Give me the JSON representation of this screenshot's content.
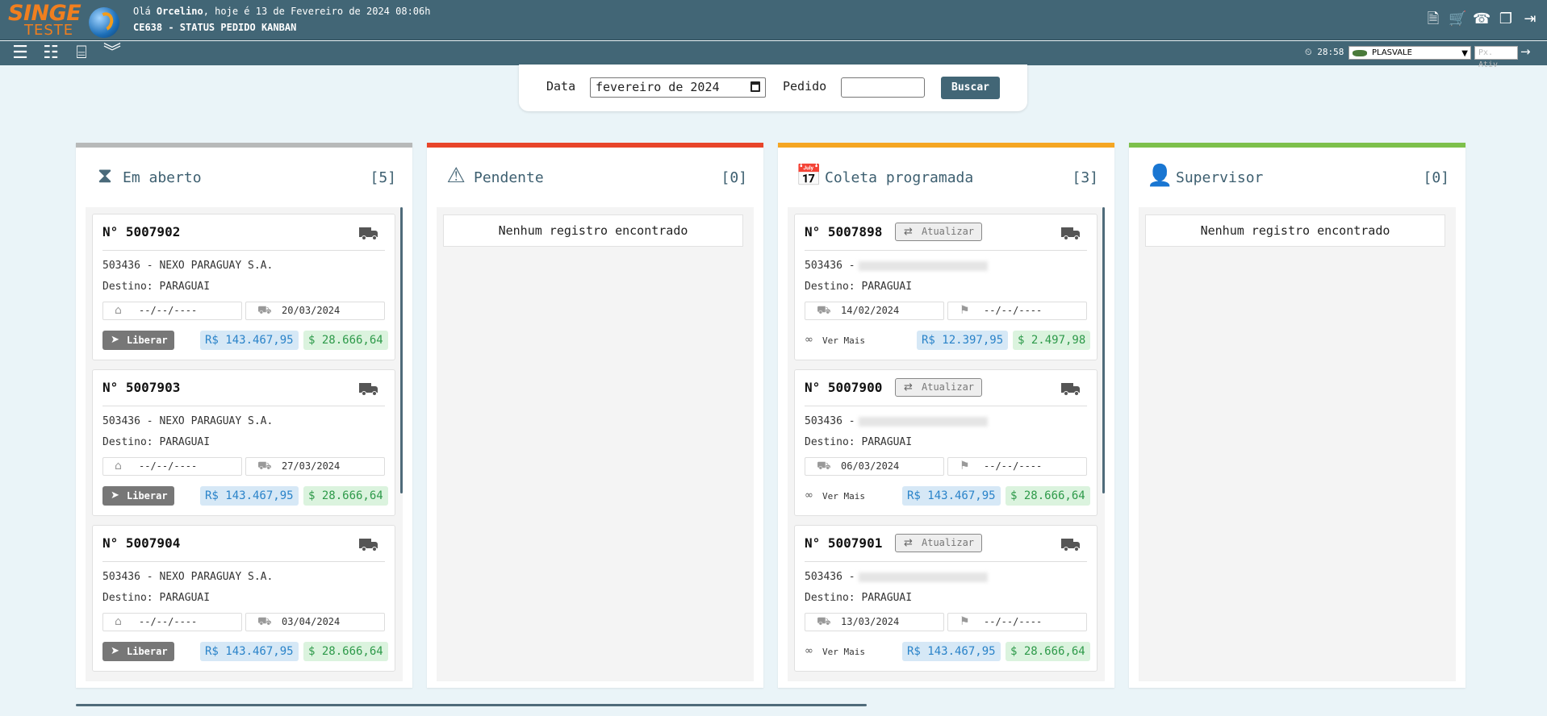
{
  "header": {
    "logo_main": "SINGE",
    "logo_sub": "TESTE",
    "greeting_prefix": "Olá ",
    "user": "Orcelino",
    "greeting_suffix": ", hoje é 13 de Fevereiro de 2024 08:06h",
    "screen_title": "CE638 - STATUS PEDIDO KANBAN",
    "top_icons": [
      "document-icon",
      "cart-icon",
      "phone-icon",
      "windows-icon",
      "logout-icon"
    ]
  },
  "toolbar": {
    "clock": "28:58",
    "company": "PLASVALE",
    "px_ativ_placeholder": "Px. Ativ"
  },
  "filter": {
    "date_label": "Data",
    "date_value": "fevereiro de 2024",
    "pedido_label": "Pedido",
    "pedido_value": "",
    "search_button": "Buscar"
  },
  "columns": [
    {
      "title": "Em aberto",
      "count": "[5]",
      "icon": "hourglass-icon",
      "color": "#b7b9b9",
      "empty_text": "",
      "cards": [
        {
          "number": "N° 5007902",
          "client": "503436 - NEXO PARAGUAY S.A.",
          "destination": "Destino: PARAGUAI",
          "date1": "--/--/----",
          "date2": "20/03/2024",
          "action": "Liberar",
          "value_brl": "R$ 143.467,95",
          "value_usd": "$ 28.666,64"
        },
        {
          "number": "N° 5007903",
          "client": "503436 - NEXO PARAGUAY S.A.",
          "destination": "Destino: PARAGUAI",
          "date1": "--/--/----",
          "date2": "27/03/2024",
          "action": "Liberar",
          "value_brl": "R$ 143.467,95",
          "value_usd": "$ 28.666,64"
        },
        {
          "number": "N° 5007904",
          "client": "503436 - NEXO PARAGUAY S.A.",
          "destination": "Destino: PARAGUAI",
          "date1": "--/--/----",
          "date2": "03/04/2024",
          "action": "Liberar",
          "value_brl": "R$ 143.467,95",
          "value_usd": "$ 28.666,64"
        }
      ]
    },
    {
      "title": "Pendente",
      "count": "[0]",
      "icon": "warning-icon",
      "color": "#e8452a",
      "empty_text": "Nenhum registro encontrado",
      "cards": []
    },
    {
      "title": "Coleta programada",
      "count": "[3]",
      "icon": "calendar-icon",
      "color": "#f5a623",
      "empty_text": "",
      "cards": [
        {
          "number": "N° 5007898",
          "update": "Atualizar",
          "client": "503436 -",
          "destination": "Destino: PARAGUAI",
          "date1": "14/02/2024",
          "date2": "--/--/----",
          "action": "Ver Mais",
          "value_brl": "R$ 12.397,95",
          "value_usd": "$ 2.497,98"
        },
        {
          "number": "N° 5007900",
          "update": "Atualizar",
          "client": "503436 -",
          "destination": "Destino: PARAGUAI",
          "date1": "06/03/2024",
          "date2": "--/--/----",
          "action": "Ver Mais",
          "value_brl": "R$ 143.467,95",
          "value_usd": "$ 28.666,64"
        },
        {
          "number": "N° 5007901",
          "update": "Atualizar",
          "client": "503436 -",
          "destination": "Destino: PARAGUAI",
          "date1": "13/03/2024",
          "date2": "--/--/----",
          "action": "Ver Mais",
          "value_brl": "R$ 143.467,95",
          "value_usd": "$ 28.666,64"
        }
      ]
    },
    {
      "title": "Supervisor",
      "count": "[0]",
      "icon": "person-icon",
      "color": "#7dc04b",
      "empty_text": "Nenhum registro encontrado",
      "cards": []
    }
  ]
}
